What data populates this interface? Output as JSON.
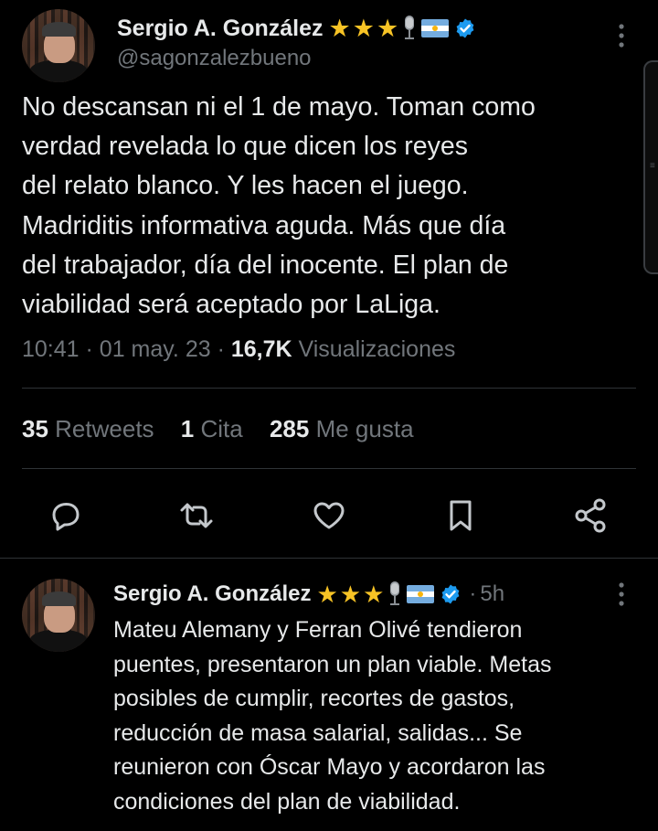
{
  "main_tweet": {
    "author": {
      "display_name": "Sergio A. González",
      "handle": "@sagonzalezbueno",
      "badges": [
        "star-emoji",
        "star-emoji",
        "star-emoji",
        "microphone-emoji",
        "argentina-flag-emoji",
        "verified-badge"
      ]
    },
    "text_lines": [
      "No descansan ni el 1 de mayo. Toman como",
      "verdad revelada lo que dicen los reyes",
      "del relato blanco. Y les hacen el juego.",
      "Madriditis informativa aguda. Más que día",
      "del trabajador, día del inocente. El plan de",
      "viabilidad será aceptado por LaLiga."
    ],
    "meta": {
      "time": "10:41",
      "dot1": "·",
      "date": "01 may. 23",
      "dot2": "·",
      "views_count": "16,7K",
      "views_label": "Visualizaciones"
    },
    "stats": {
      "retweets_count": "35",
      "retweets_label": "Retweets",
      "quotes_count": "1",
      "quotes_label": "Cita",
      "likes_count": "285",
      "likes_label": "Me gusta"
    },
    "actions": [
      "reply-icon",
      "retweet-icon",
      "like-icon",
      "bookmark-icon",
      "share-icon"
    ]
  },
  "reply_tweet": {
    "author": {
      "display_name": "Sergio A. González",
      "time_ago": "5h",
      "dot": "·"
    },
    "text_lines": [
      "Mateu Alemany y Ferran Olivé tendieron",
      "puentes, presentaron un plan viable. Metas",
      "posibles de cumplir, recortes de gastos,",
      "reducción de masa salarial, salidas... Se",
      "reunieron con Óscar Mayo y acordaron las",
      "condiciones del plan de viabilidad."
    ]
  },
  "colors": {
    "background": "#000000",
    "text_primary": "#e7e9ea",
    "text_secondary": "#71767b",
    "verified_blue": "#1d9bf0",
    "star_gold": "#f7c325",
    "divider": "#2f3336"
  }
}
